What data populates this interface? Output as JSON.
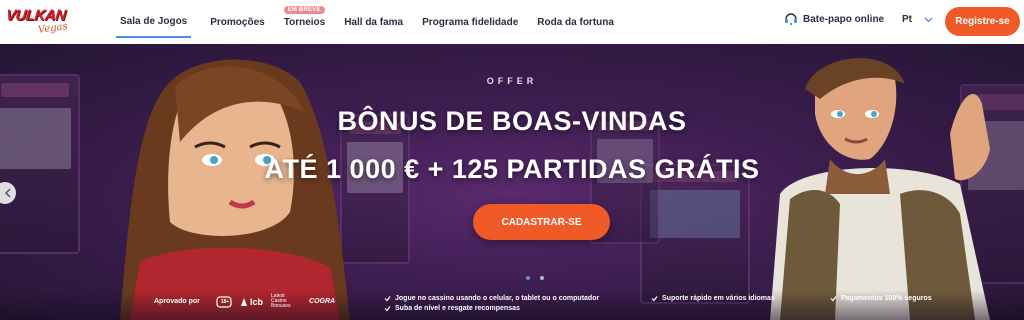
{
  "header": {
    "logo": {
      "word": "VULKAN",
      "sub": "Vegas"
    },
    "nav": [
      {
        "label": "Sala de Jogos",
        "active": true
      },
      {
        "label": "Promoções",
        "active": false
      },
      {
        "label": "Torneios",
        "active": false,
        "badge": "EM BREVE"
      },
      {
        "label": "Hall da fama",
        "active": false
      },
      {
        "label": "Programa fidelidade",
        "active": false
      },
      {
        "label": "Roda da fortuna",
        "active": false
      }
    ],
    "chat_label": "Bate-papo online",
    "language": "Pt",
    "register_label": "Registre-se"
  },
  "hero": {
    "eyebrow": "OFFER",
    "headline_line1": "BÔNUS DE BOAS-VINDAS",
    "headline_line2": "ATÉ 1 000 € + 125 PARTIDAS GRÁTIS",
    "cta_label": "CADASTRAR-SE",
    "slides": 2,
    "active_slide": 1
  },
  "footer": {
    "approved_label": "Aprovado por",
    "partners": [
      "18+",
      "lcb",
      "Latest Casino Bonuses",
      "COGRA"
    ],
    "features": [
      "Jogue no cassino usando o celular, o tablet ou o computador",
      "Suba de nível e resgate recompensas",
      "Suporte rápido em vários idiomas",
      "Pagamentos 100% seguros"
    ]
  },
  "colors": {
    "accent": "#f05a28",
    "nav_active": "#4a8fe7",
    "hero_bg": "#3c1d4f",
    "logo_red": "#d21f2b"
  },
  "icons": {
    "chat": "headset-chat-icon",
    "language_chevron": "chevron-down-icon",
    "prev": "arrow-left-icon",
    "check": "check-icon"
  }
}
